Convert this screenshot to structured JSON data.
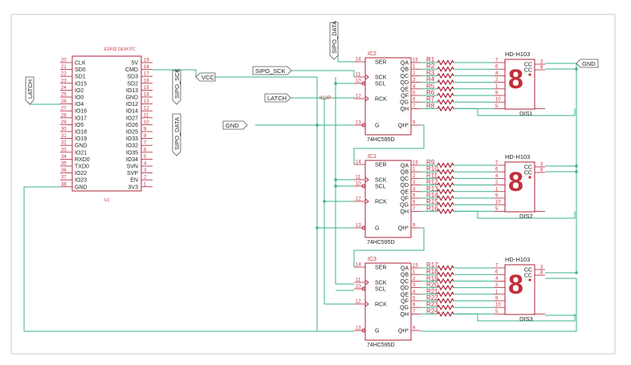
{
  "esp32": {
    "title": "ESP32 DEVKITC",
    "ref": "U1",
    "left_pins": [
      {
        "num": "20",
        "name": "CLK"
      },
      {
        "num": "21",
        "name": "SD0"
      },
      {
        "num": "22",
        "name": "SD1"
      },
      {
        "num": "23",
        "name": "IO15"
      },
      {
        "num": "24",
        "name": "IO2"
      },
      {
        "num": "25",
        "name": "IO0"
      },
      {
        "num": "26",
        "name": "IO4"
      },
      {
        "num": "27",
        "name": "IO16"
      },
      {
        "num": "28",
        "name": "IO17"
      },
      {
        "num": "29",
        "name": "IO5"
      },
      {
        "num": "30",
        "name": "IO18"
      },
      {
        "num": "31",
        "name": "IO19"
      },
      {
        "num": "32",
        "name": "GND"
      },
      {
        "num": "33",
        "name": "IO21"
      },
      {
        "num": "34",
        "name": "RXD0"
      },
      {
        "num": "35",
        "name": "TXD0"
      },
      {
        "num": "36",
        "name": "IO22"
      },
      {
        "num": "37",
        "name": "IO23"
      },
      {
        "num": "38",
        "name": "GND"
      }
    ],
    "right_pins": [
      {
        "num": "19",
        "name": "5V"
      },
      {
        "num": "18",
        "name": "CMD"
      },
      {
        "num": "17",
        "name": "SD3"
      },
      {
        "num": "16",
        "name": "SD2"
      },
      {
        "num": "15",
        "name": "IO13"
      },
      {
        "num": "14",
        "name": "GND"
      },
      {
        "num": "13",
        "name": "IO12"
      },
      {
        "num": "12",
        "name": "IO14"
      },
      {
        "num": "11",
        "name": "IO27"
      },
      {
        "num": "10",
        "name": "IO26"
      },
      {
        "num": "9",
        "name": "IO25"
      },
      {
        "num": "8",
        "name": "IO33"
      },
      {
        "num": "7",
        "name": "IO32"
      },
      {
        "num": "6",
        "name": "IO35"
      },
      {
        "num": "5",
        "name": "IO34"
      },
      {
        "num": "4",
        "name": "SVN"
      },
      {
        "num": "3",
        "name": "SVP"
      },
      {
        "num": "2",
        "name": "EN"
      },
      {
        "num": "1",
        "name": "3V3"
      }
    ]
  },
  "net_labels": {
    "latch_left": "LATCH",
    "sipo_sck_vert": "SIPO_SCK",
    "sipo_data_vert": "SIPO_DATA",
    "sipo_data_top": "SIPO_DATA",
    "vcc": "VCC",
    "sipo_sck": "SIPO_SCK",
    "latch": "LATCH",
    "gnd_left": "GND",
    "gnd_right": "GND",
    "ic2p": "IC2P"
  },
  "ics": [
    {
      "ref": "IC2",
      "part": "74HC595D"
    },
    {
      "ref": "IC1",
      "part": "74HC595D"
    },
    {
      "ref": "IC3",
      "part": "74HC595D"
    }
  ],
  "ic_left_pins": [
    {
      "num": "14",
      "name": "SER"
    },
    {
      "num": "11",
      "name": "SCK"
    },
    {
      "num": "10",
      "name": "SCL"
    },
    {
      "num": "12",
      "name": "RCK"
    },
    {
      "num": "13",
      "name": "G"
    }
  ],
  "ic_right_pins": [
    {
      "num": "15",
      "name": "QA"
    },
    {
      "num": "1",
      "name": "QB"
    },
    {
      "num": "2",
      "name": "QC"
    },
    {
      "num": "3",
      "name": "QD"
    },
    {
      "num": "4",
      "name": "QE"
    },
    {
      "num": "5",
      "name": "QF"
    },
    {
      "num": "6",
      "name": "QG"
    },
    {
      "num": "7",
      "name": "QH"
    },
    {
      "num": "9",
      "name": "QH*"
    }
  ],
  "resistors": [
    [
      "R1",
      "R2",
      "R3",
      "R4",
      "R5",
      "R6",
      "R7",
      "R8"
    ],
    [
      "R9",
      "R10",
      "R11",
      "R12",
      "R13",
      "R14",
      "R15",
      "R16"
    ],
    [
      "R17",
      "R18",
      "R19",
      "R20",
      "R21",
      "R22",
      "R23",
      "R24"
    ]
  ],
  "displays": [
    {
      "part": "HD-H103",
      "ref": "DIS1"
    },
    {
      "part": "HD-H103",
      "ref": "DIS2"
    },
    {
      "part": "HD-H103",
      "ref": "DIS3"
    }
  ],
  "disp_pin_nums": [
    "7",
    "6",
    "4",
    "2",
    "1",
    "9",
    "10",
    "5"
  ],
  "disp_cc_pins": [
    "3",
    "8"
  ],
  "disp_cc_label": "CC",
  "seven_seg_char": "8"
}
